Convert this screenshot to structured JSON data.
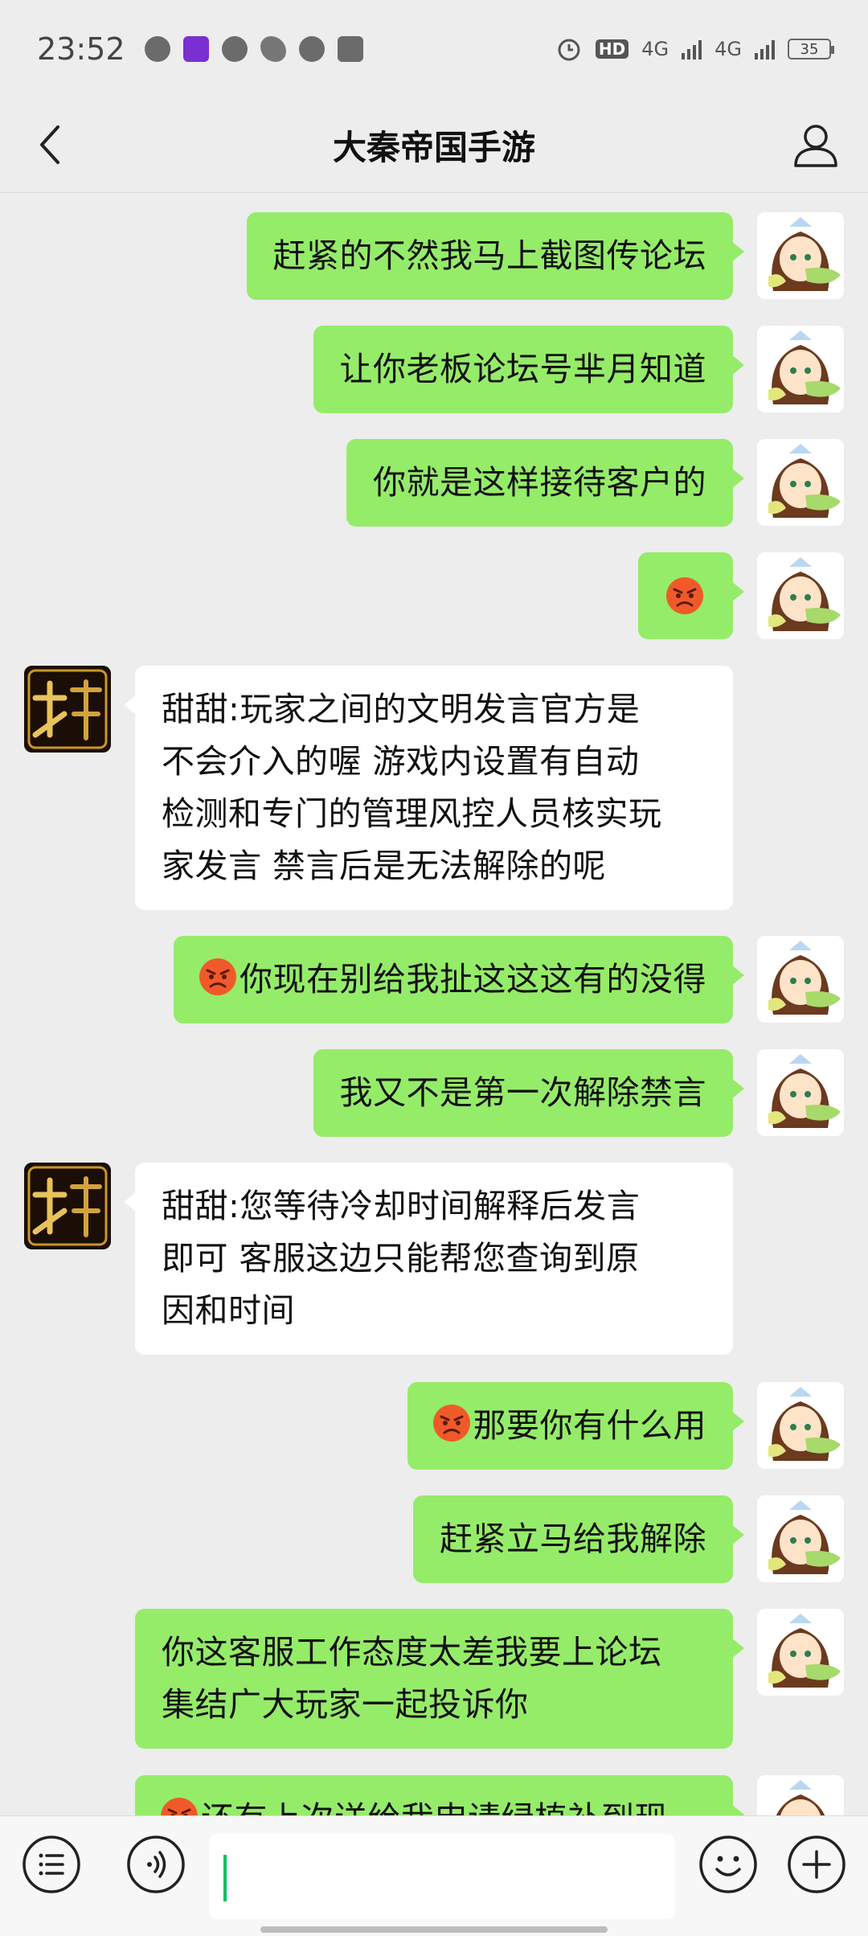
{
  "status": {
    "time": "23:52",
    "hd_label": "HD",
    "sim1": "4G",
    "sim2": "4G",
    "battery": "35"
  },
  "header": {
    "title": "大秦帝国手游"
  },
  "messages": [
    {
      "side": "me",
      "text": "赶紧的不然我马上截图传论坛"
    },
    {
      "side": "me",
      "text": "让你老板论坛号芈月知道"
    },
    {
      "side": "me",
      "text": "你就是这样接待客户的"
    },
    {
      "side": "me",
      "emoji": "angry-face",
      "text": ""
    },
    {
      "side": "them",
      "text": "甜甜:玩家之间的文明发言官方是\n不会介入的喔 游戏内设置有自动\n检测和专门的管理风控人员核实玩\n家发言 禁言后是无法解除的呢"
    },
    {
      "side": "me",
      "emoji": "angry-face",
      "text": "你现在别给我扯这这这有的没得"
    },
    {
      "side": "me",
      "text": "我又不是第一次解除禁言"
    },
    {
      "side": "them",
      "text": "甜甜:您等待冷却时间解释后发言\n即可 客服这边只能帮您查询到原\n因和时间"
    },
    {
      "side": "me",
      "emoji": "angry-face",
      "text": "那要你有什么用"
    },
    {
      "side": "me",
      "text": "赶紧立马给我解除"
    },
    {
      "side": "me",
      "text": "你这客服工作态度太差我要上论坛\n集结广大玩家一起投诉你"
    },
    {
      "side": "me",
      "emoji": "angry-face",
      "text": "还有上次送给我申请绿植补到现"
    }
  ],
  "input": {
    "value": ""
  },
  "colors": {
    "bubble_me": "#95ec69",
    "bubble_them": "#ffffff",
    "background": "#ededed"
  }
}
